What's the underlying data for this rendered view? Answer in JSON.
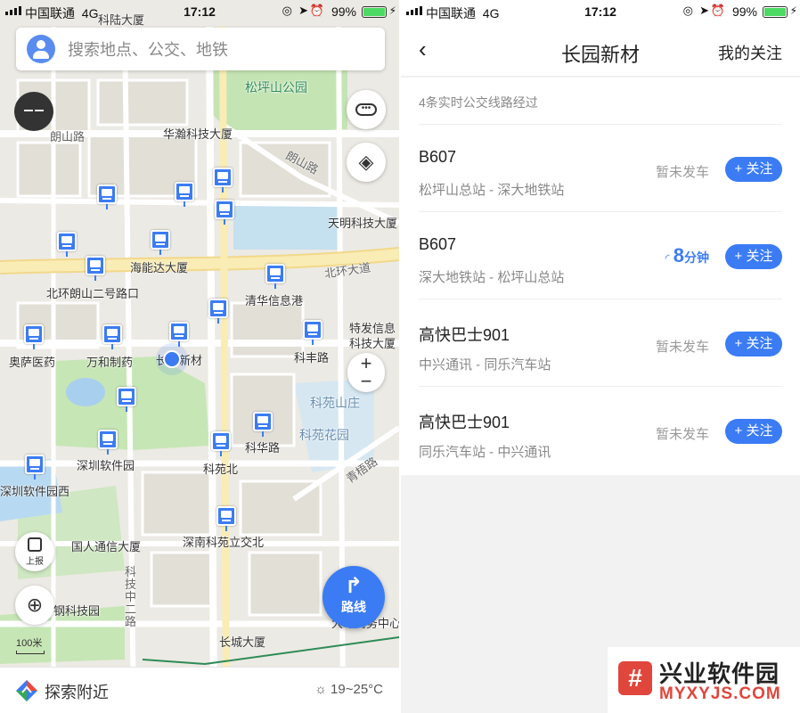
{
  "status_left": {
    "carrier": "中国联通",
    "network": "4G",
    "time": "17:12",
    "battery": "99%"
  },
  "status_right": {
    "carrier": "中国联通",
    "network": "4G",
    "time": "17:12",
    "battery": "99%"
  },
  "map": {
    "search_placeholder": "搜索地点、公交、地铁",
    "labels": {
      "keliu": "科陆大厦",
      "songpingshan_park": "松坪山公园",
      "langshan_road": "朗山路",
      "huahan": "华瀚科技大厦",
      "langshan_road2": "朗山路",
      "tianming": "天明科技大厦",
      "hainengda": "海能达大厦",
      "beihuan_road": "北环大道",
      "beihuan_langshan": "北环朗山二号路口",
      "tsinghua": "清华信息港",
      "tefa": "特发信息",
      "tefa2": "科技大厦",
      "aosa": "奥萨医药",
      "wanhe": "万和制药",
      "changyuan": "长园新材",
      "kefeng": "科丰路",
      "keyuan_shanzhuang": "科苑山庄",
      "keyuan_garden": "科苑花园",
      "kehua": "科华路",
      "shenzhen_soft": "深圳软件园",
      "keyuan_north": "科苑北",
      "soft_west": "深圳软件园西",
      "qingwu": "青梧路",
      "shennan_keyuan": "深南科苑立交北",
      "guoren": "国人通信大厦",
      "keji_zhong_er": "科技中二路",
      "gangke": "钢科技园",
      "changcheng": "长城大厦",
      "yishi": "大冲商务中心"
    },
    "report_label": "上报",
    "route_label": "路线",
    "scale_label": "100米",
    "explore_label": "探索附近",
    "weather": "19~25°C",
    "zoom_in": "+",
    "zoom_out": "−"
  },
  "detail": {
    "title": "长园新材",
    "my_follow": "我的关注",
    "summary": "4条实时公交线路经过",
    "follow_label": "+ 关注",
    "routes": [
      {
        "name": "B607",
        "direction": "松坪山总站 - 深大地铁站",
        "state": "暂未发车"
      },
      {
        "name": "B607",
        "direction": "深大地铁站 - 松坪山总站",
        "eta_value": "8",
        "eta_unit": "分钟"
      },
      {
        "name": "高快巴士901",
        "direction": "中兴通讯 - 同乐汽车站",
        "state": "暂未发车"
      },
      {
        "name": "高快巴士901",
        "direction": "同乐汽车站 - 中兴通讯",
        "state": "暂未发车"
      }
    ]
  },
  "watermark": {
    "title": "兴业软件园",
    "url": "MYXYJS.COM"
  },
  "colors": {
    "accent": "#3b7cf4",
    "park": "#b9dfa8",
    "water": "#a9cfee",
    "road_main": "#f7e7a0"
  }
}
